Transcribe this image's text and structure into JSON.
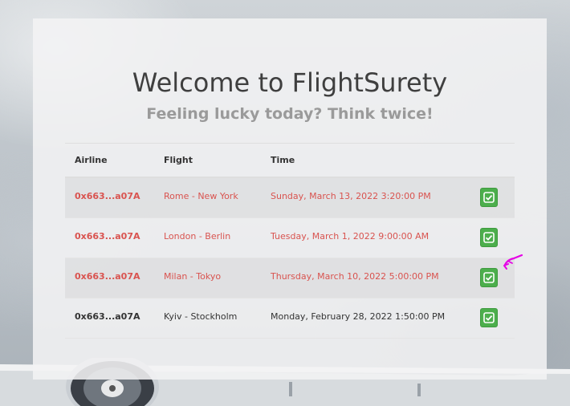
{
  "header": {
    "title": "Welcome to FlightSurety",
    "subtitle": "Feeling lucky today? Think twice!"
  },
  "table": {
    "columns": [
      "Airline",
      "Flight",
      "Time"
    ],
    "rows": [
      {
        "airline": "0x663...a07A",
        "flight": "Rome - New York",
        "time": "Sunday, March 13, 2022 3:20:00 PM",
        "status": "danger"
      },
      {
        "airline": "0x663...a07A",
        "flight": "London - Berlin",
        "time": "Tuesday, March 1, 2022 9:00:00 AM",
        "status": "danger"
      },
      {
        "airline": "0x663...a07A",
        "flight": "Milan - Tokyo",
        "time": "Thursday, March 10, 2022 5:00:00 PM",
        "status": "danger"
      },
      {
        "airline": "0x663...a07A",
        "flight": "Kyiv - Stockholm",
        "time": "Monday, February 28, 2022 1:50:00 PM",
        "status": "normal"
      }
    ]
  },
  "icons": {
    "row_action": "check-square-icon",
    "pointer": "hand-pointer-icon"
  },
  "colors": {
    "danger_text": "#d9534f",
    "button_green": "#4cae4c",
    "cursor_magenta": "#e600e6"
  }
}
